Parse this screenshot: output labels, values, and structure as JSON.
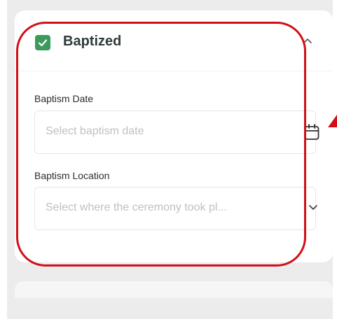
{
  "section": {
    "title": "Baptized",
    "checked": true,
    "expanded": true
  },
  "fields": {
    "date": {
      "label": "Baptism Date",
      "placeholder": "Select baptism date",
      "icon": "calendar-icon"
    },
    "location": {
      "label": "Baptism Location",
      "placeholder": "Select where the ceremony took pl...",
      "icon": "chevron-down-icon"
    }
  },
  "colors": {
    "checkbox": "#3c9a5c",
    "annotation": "#d20f16"
  }
}
